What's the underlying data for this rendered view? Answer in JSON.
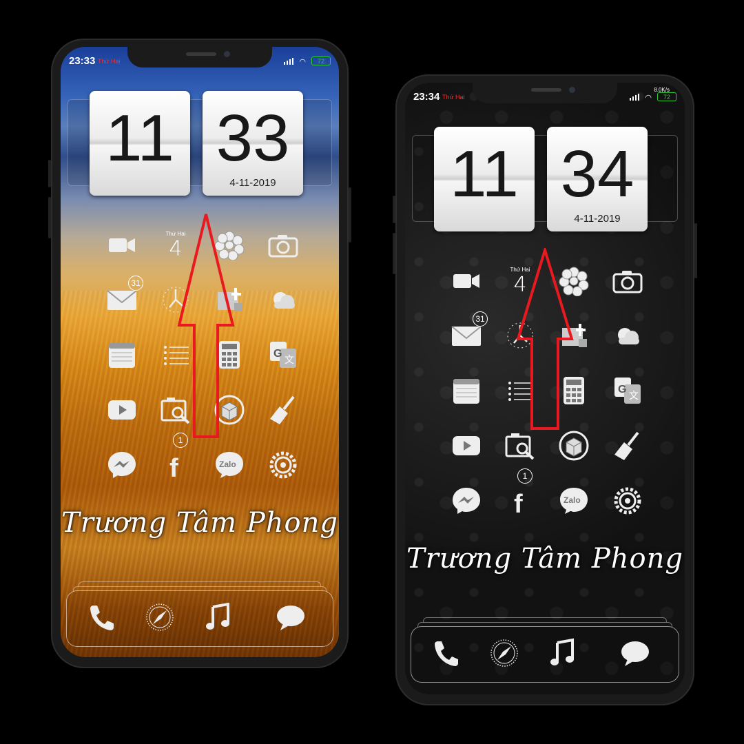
{
  "phones": [
    {
      "status": {
        "time": "23:33",
        "day": "Thứ Hai",
        "battery": "72",
        "net_rate": ""
      },
      "clock": {
        "hour": "11",
        "minute": "33",
        "date": "4-11-2019"
      },
      "calendar": {
        "day": "Thứ Hai",
        "num": "4"
      },
      "badges": {
        "mail": "31",
        "facebook": "1"
      },
      "apps": [
        "facetime-icon",
        "calendar-icon",
        "photos-icon",
        "camera-icon",
        "mail-icon",
        "clock-icon",
        "calculator-tools-icon",
        "weather-icon",
        "notes-icon",
        "reminders-icon",
        "calculator-icon",
        "translate-icon",
        "youtube-icon",
        "gallery-search-icon",
        "cydia-icon",
        "cleaner-icon",
        "messenger-icon",
        "facebook-icon",
        "zalo-icon",
        "settings-icon"
      ],
      "zalo_label": "Zalo",
      "signature": "Trương Tâm Phong",
      "dock": [
        "phone-icon",
        "safari-icon",
        "music-icon",
        "messages-icon"
      ]
    },
    {
      "status": {
        "time": "23:34",
        "day": "Thứ Hai",
        "battery": "72",
        "net_rate": "8.0K/s"
      },
      "clock": {
        "hour": "11",
        "minute": "34",
        "date": "4-11-2019"
      },
      "calendar": {
        "day": "Thứ Hai",
        "num": "4"
      },
      "badges": {
        "mail": "31",
        "facebook": "1"
      },
      "apps": [
        "facetime-icon",
        "calendar-icon",
        "photos-icon",
        "camera-icon",
        "mail-icon",
        "clock-icon",
        "calculator-tools-icon",
        "weather-icon",
        "notes-icon",
        "reminders-icon",
        "calculator-icon",
        "translate-icon",
        "youtube-icon",
        "gallery-search-icon",
        "cydia-icon",
        "cleaner-icon",
        "messenger-icon",
        "facebook-icon",
        "zalo-icon",
        "settings-icon"
      ],
      "zalo_label": "Zalo",
      "signature": "Trương Tâm Phong",
      "dock": [
        "phone-icon",
        "safari-icon",
        "music-icon",
        "messages-icon"
      ]
    }
  ],
  "colors": {
    "arrow": "#e8191f",
    "status_day": "#ee3333",
    "battery": "#33cc33"
  }
}
